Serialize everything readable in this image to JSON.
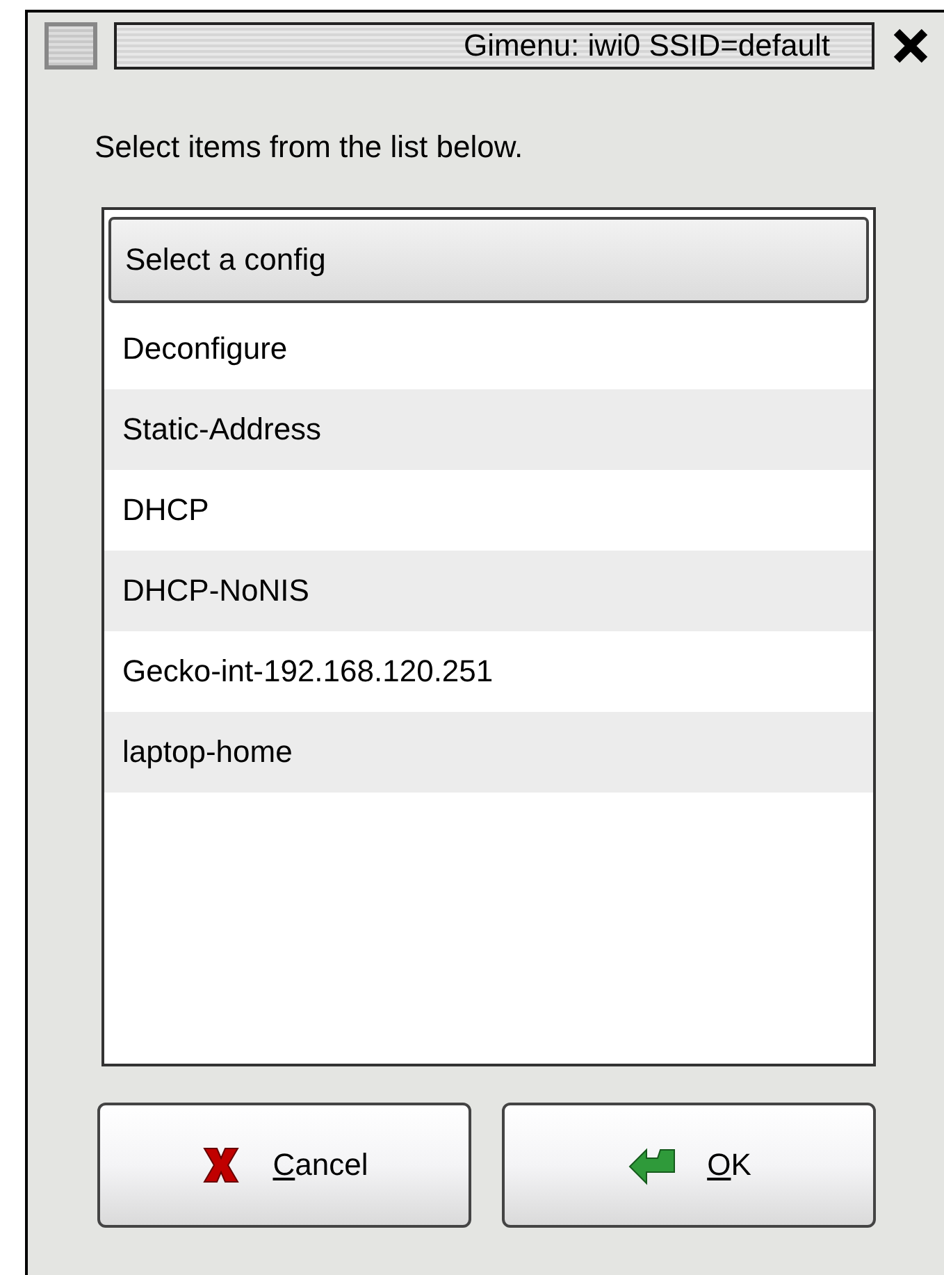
{
  "window": {
    "title": "Gimenu: iwi0 SSID=default"
  },
  "prompt": "Select items from the list below.",
  "list": {
    "header": "Select a config",
    "rows": [
      {
        "label": "Deconfigure"
      },
      {
        "label": "Static-Address"
      },
      {
        "label": "DHCP"
      },
      {
        "label": "DHCP-NoNIS"
      },
      {
        "label": "Gecko-int-192.168.120.251"
      },
      {
        "label": "laptop-home"
      }
    ]
  },
  "buttons": [
    {
      "kind": "cancel",
      "label": "Cancel",
      "mnemonic": true
    },
    {
      "kind": "ok",
      "label": "OK",
      "mnemonic": true
    }
  ]
}
